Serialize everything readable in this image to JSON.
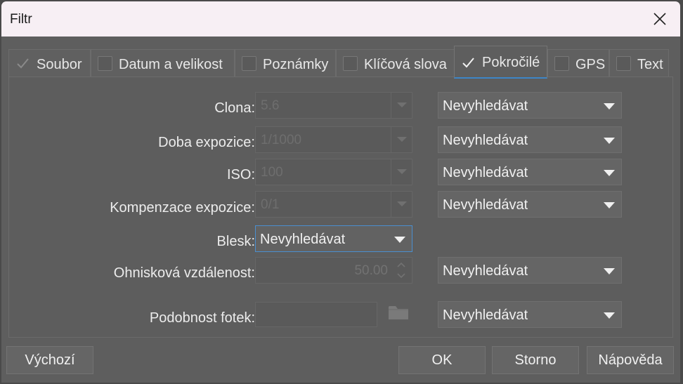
{
  "window": {
    "title": "Filtr"
  },
  "tabs": [
    {
      "label": "Soubor",
      "checked": true,
      "dim": true
    },
    {
      "label": "Datum a velikost",
      "checked": false
    },
    {
      "label": "Poznámky",
      "checked": false
    },
    {
      "label": "Klíčová slova",
      "checked": false
    },
    {
      "label": "Pokročilé",
      "checked": true,
      "active": true
    },
    {
      "label": "GPS",
      "checked": false
    },
    {
      "label": "Text",
      "checked": false
    }
  ],
  "fields": {
    "clona": {
      "label": "Clona:",
      "value": "5.6",
      "mode": "Nevyhledávat"
    },
    "doba": {
      "label": "Doba expozice:",
      "value": "1/1000",
      "mode": "Nevyhledávat"
    },
    "iso": {
      "label": "ISO:",
      "value": "100",
      "mode": "Nevyhledávat"
    },
    "kompenzace": {
      "label": "Kompenzace expozice:",
      "value": "0/1",
      "mode": "Nevyhledávat"
    },
    "blesk": {
      "label": "Blesk:",
      "value": "Nevyhledávat"
    },
    "ohnisko": {
      "label": "Ohnisková vzdálenost:",
      "value": "50.00",
      "mode": "Nevyhledávat"
    },
    "podobnost": {
      "label": "Podobnost fotek:",
      "value": "",
      "mode": "Nevyhledávat"
    }
  },
  "buttons": {
    "default": "Výchozí",
    "ok": "OK",
    "cancel": "Storno",
    "help": "Nápověda"
  },
  "icons": {
    "close": "close-icon",
    "dropdown": "chevron-down-icon",
    "folder": "folder-icon",
    "spin": "spin-arrows-icon",
    "check": "checkmark-icon"
  },
  "colors": {
    "accent": "#3d86c8",
    "titlebar": "#f7eff4",
    "panel": "#5e5e5e"
  }
}
